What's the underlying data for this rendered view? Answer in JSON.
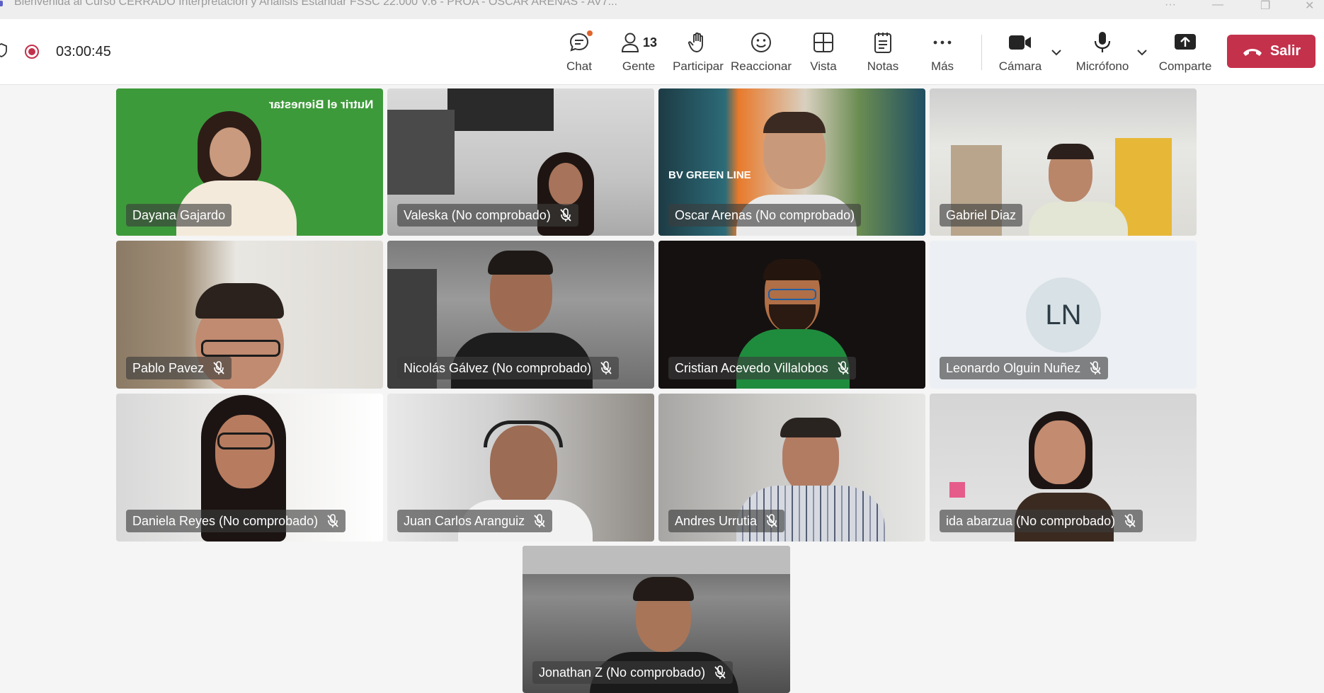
{
  "window": {
    "title": "Bienvenida al Curso CERRADO Interpretación y Análisis Estándar FSSC 22.000 V.6 - PROA - OSCAR ARENAS - AV7..."
  },
  "toolbar": {
    "timer": "03:00:45",
    "chat_label": "Chat",
    "people_label": "Gente",
    "people_count": "13",
    "raise_hand_label": "Participar",
    "react_label": "Reaccionar",
    "view_label": "Vista",
    "notes_label": "Notas",
    "more_label": "Más",
    "camera_label": "Cámara",
    "mic_label": "Micrófono",
    "share_label": "Comparte",
    "leave_label": "Salir",
    "leave_color": "#c4314b"
  },
  "participants": [
    {
      "name": "Dayana Gajardo",
      "muted": false,
      "background_text": "Nutrir el Bienestar"
    },
    {
      "name": "Valeska (No comprobado)",
      "muted": true
    },
    {
      "name": "Oscar Arenas (No comprobado)",
      "muted": false,
      "background_text": "BV GREEN LINE"
    },
    {
      "name": "Gabriel Diaz",
      "muted": false
    },
    {
      "name": "Pablo Pavez",
      "muted": true
    },
    {
      "name": "Nicolás Gálvez (No comprobado)",
      "muted": true
    },
    {
      "name": "Cristian Acevedo Villalobos",
      "muted": true
    },
    {
      "name": "Leonardo Olguin Nuñez",
      "muted": true,
      "initials": "LN"
    },
    {
      "name": "Daniela Reyes (No comprobado)",
      "muted": true
    },
    {
      "name": "Juan Carlos Aranguiz",
      "muted": true
    },
    {
      "name": "Andres Urrutia",
      "muted": true
    },
    {
      "name": "ida abarzua (No comprobado)",
      "muted": true
    },
    {
      "name": "Jonathan Z (No comprobado)",
      "muted": true
    }
  ]
}
